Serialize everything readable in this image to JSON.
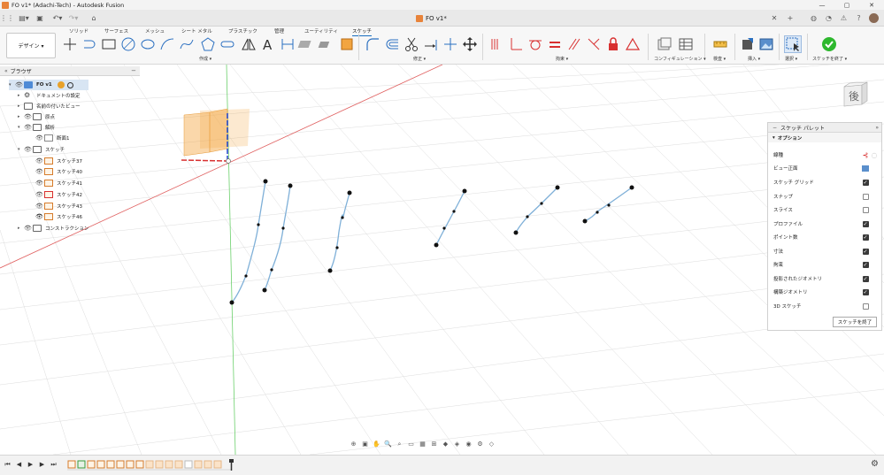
{
  "window": {
    "title": "FO v1* (Adachi-Tech) - Autodesk Fusion",
    "controls": [
      "—",
      "▢",
      "✕"
    ]
  },
  "document_tab": {
    "label": "FO v1*"
  },
  "ribbon": {
    "tabs": [
      "ソリッド",
      "サーフェス",
      "メッシュ",
      "シート メタル",
      "プラスチック",
      "管理",
      "ユーティリティ",
      "スケッチ"
    ],
    "active_tab": "スケッチ",
    "workspace_button": "デザイン ▾",
    "groups": {
      "create": "作成 ▾",
      "modify": "修正 ▾",
      "constraints": "拘束 ▾",
      "configure": "コンフィギュレーション ▾",
      "inspect": "検査 ▾",
      "insert": "挿入 ▾",
      "select": "選択 ▾",
      "finish": "スケッチを終了 ▾"
    }
  },
  "browser": {
    "title": "ブラウザ",
    "items": [
      {
        "label": "FO v1",
        "type": "comp"
      },
      {
        "label": "ドキュメントの設定",
        "type": "gear"
      },
      {
        "label": "名前の付いたビュー",
        "type": "folder"
      },
      {
        "label": "原点",
        "type": "folder"
      },
      {
        "label": "解析",
        "type": "folder"
      },
      {
        "label": "断面1",
        "type": "view"
      },
      {
        "label": "スケッチ",
        "type": "folder"
      },
      {
        "label": "スケッチ37",
        "type": "sketch"
      },
      {
        "label": "スケッチ40",
        "type": "sketch"
      },
      {
        "label": "スケッチ41",
        "type": "sketch"
      },
      {
        "label": "スケッチ42",
        "type": "sketch"
      },
      {
        "label": "スケッチ43",
        "type": "sketch"
      },
      {
        "label": "スケッチ46",
        "type": "sketch"
      },
      {
        "label": "コンストラクション",
        "type": "folder"
      }
    ]
  },
  "palette": {
    "title": "スケッチ パレット",
    "section": "オプション",
    "rows": [
      {
        "label": "線種",
        "control": "icon"
      },
      {
        "label": "ビュー正面",
        "control": "icon"
      },
      {
        "label": "スケッチ グリッド",
        "checked": true
      },
      {
        "label": "スナップ",
        "checked": false
      },
      {
        "label": "スライス",
        "checked": false
      },
      {
        "label": "プロファイル",
        "checked": true
      },
      {
        "label": "ポイント数",
        "checked": true
      },
      {
        "label": "寸法",
        "checked": true
      },
      {
        "label": "拘束",
        "checked": true
      },
      {
        "label": "投影されたジオメトリ",
        "checked": true
      },
      {
        "label": "構築ジオメトリ",
        "checked": true
      },
      {
        "label": "3D スケッチ",
        "checked": false
      }
    ],
    "finish_button": "スケッチを終了"
  },
  "viewcube": {
    "face_label": "後"
  },
  "colors": {
    "accent": "#1a6fc0",
    "spline": "#7fb0d8",
    "axis_x": "#d84040",
    "axis_y": "#3ec23e",
    "axis_z": "#2040d0",
    "origin_plane": "#f5a742",
    "finish_check": "#2eb82e"
  }
}
